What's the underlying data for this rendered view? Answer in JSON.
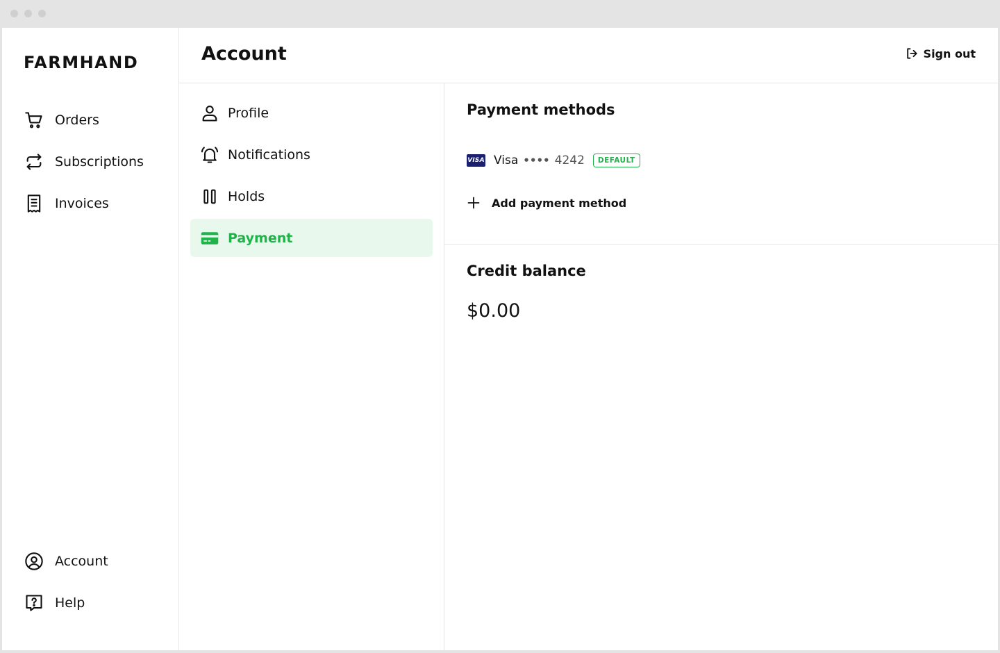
{
  "brand": {
    "name": "FARMHAND"
  },
  "sidebar": {
    "top_items": [
      {
        "label": "Orders",
        "icon": "cart-icon"
      },
      {
        "label": "Subscriptions",
        "icon": "repeat-icon"
      },
      {
        "label": "Invoices",
        "icon": "receipt-icon"
      }
    ],
    "bottom_items": [
      {
        "label": "Account",
        "icon": "user-circle-icon"
      },
      {
        "label": "Help",
        "icon": "help-icon"
      }
    ]
  },
  "header": {
    "title": "Account",
    "signout_label": "Sign out"
  },
  "subnav": {
    "items": [
      {
        "label": "Profile",
        "icon": "user-icon",
        "active": false
      },
      {
        "label": "Notifications",
        "icon": "bell-icon",
        "active": false
      },
      {
        "label": "Holds",
        "icon": "pause-icon",
        "active": false
      },
      {
        "label": "Payment",
        "icon": "credit-card-icon",
        "active": true
      }
    ]
  },
  "payment": {
    "title": "Payment methods",
    "card": {
      "logo_text": "VISA",
      "brand": "Visa",
      "dots": "••••",
      "last4": "4242",
      "badge": "DEFAULT"
    },
    "add_label": "Add payment method"
  },
  "credit": {
    "title": "Credit balance",
    "amount": "$0.00"
  },
  "colors": {
    "accent": "#20b34a",
    "active_bg": "#e9f8ed",
    "visa_blue": "#1a1f71"
  }
}
